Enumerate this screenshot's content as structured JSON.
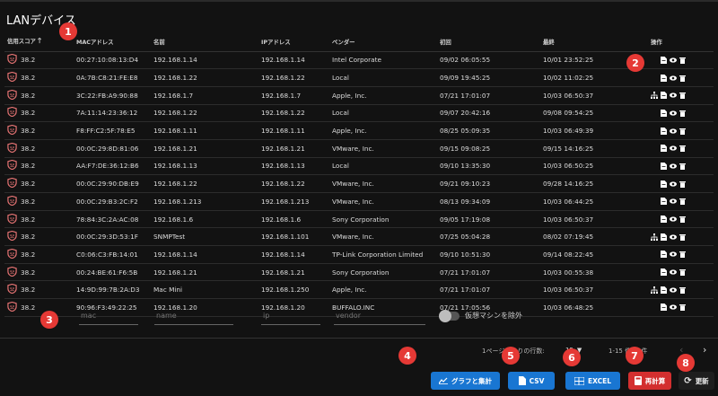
{
  "page_title": "LANデバイス",
  "columns": {
    "score": "信用スコア",
    "mac": "MACアドレス",
    "name": "名前",
    "ip": "IPアドレス",
    "vendor": "ベンダー",
    "first": "初回",
    "last": "最終",
    "actions": "操作"
  },
  "rows": [
    {
      "score": "38.2",
      "mac": "00:27:10:08:13:D4",
      "name": "192.168.1.14",
      "ip": "192.168.1.14",
      "vendor": "Intel Corporate",
      "first": "09/02 06:05:55",
      "last": "10/01 23:52:25",
      "icons": [
        "file-icon",
        "eye-icon",
        "trash-icon"
      ]
    },
    {
      "score": "38.2",
      "mac": "0A:7B:C8:21:FE:E8",
      "name": "192.168.1.22",
      "ip": "192.168.1.22",
      "vendor": "Local",
      "first": "09/09 19:45:25",
      "last": "10/02 11:02:25",
      "icons": [
        "file-icon",
        "eye-icon",
        "trash-icon"
      ]
    },
    {
      "score": "38.2",
      "mac": "3C:22:FB:A9:90:88",
      "name": "192.168.1.7",
      "ip": "192.168.1.7",
      "vendor": "Apple, Inc.",
      "first": "07/21 17:01:07",
      "last": "10/03 06:50:37",
      "icons": [
        "network-icon",
        "file-icon",
        "eye-icon",
        "trash-icon"
      ]
    },
    {
      "score": "38.2",
      "mac": "7A:11:14:23:36:12",
      "name": "192.168.1.22",
      "ip": "192.168.1.22",
      "vendor": "Local",
      "first": "09/07 20:42:16",
      "last": "09/08 09:54:25",
      "icons": [
        "file-icon",
        "eye-icon",
        "trash-icon"
      ]
    },
    {
      "score": "38.2",
      "mac": "F8:FF:C2:5F:78:E5",
      "name": "192.168.1.11",
      "ip": "192.168.1.11",
      "vendor": "Apple, Inc.",
      "first": "08/25 05:09:35",
      "last": "10/03 06:49:39",
      "icons": [
        "file-icon",
        "eye-icon",
        "trash-icon"
      ]
    },
    {
      "score": "38.2",
      "mac": "00:0C:29:8D:81:06",
      "name": "192.168.1.21",
      "ip": "192.168.1.21",
      "vendor": "VMware, Inc.",
      "first": "09/15 09:08:25",
      "last": "09/15 14:16:25",
      "icons": [
        "file-icon",
        "eye-icon",
        "trash-icon"
      ]
    },
    {
      "score": "38.2",
      "mac": "AA:F7:DE:36:12:B6",
      "name": "192.168.1.13",
      "ip": "192.168.1.13",
      "vendor": "Local",
      "first": "09/10 13:35:30",
      "last": "10/03 06:50:25",
      "icons": [
        "file-icon",
        "eye-icon",
        "trash-icon"
      ]
    },
    {
      "score": "38.2",
      "mac": "00:0C:29:90:DB:E9",
      "name": "192.168.1.22",
      "ip": "192.168.1.22",
      "vendor": "VMware, Inc.",
      "first": "09/21 09:10:23",
      "last": "09/28 14:16:25",
      "icons": [
        "file-icon",
        "eye-icon",
        "trash-icon"
      ]
    },
    {
      "score": "38.2",
      "mac": "00:0C:29:B3:2C:F2",
      "name": "192.168.1.213",
      "ip": "192.168.1.213",
      "vendor": "VMware, Inc.",
      "first": "08/13 09:34:09",
      "last": "10/03 06:44:25",
      "icons": [
        "file-icon",
        "eye-icon",
        "trash-icon"
      ]
    },
    {
      "score": "38.2",
      "mac": "78:84:3C:2A:AC:08",
      "name": "192.168.1.6",
      "ip": "192.168.1.6",
      "vendor": "Sony Corporation",
      "first": "09/05 17:19:08",
      "last": "10/03 06:50:37",
      "icons": [
        "file-icon",
        "eye-icon",
        "trash-icon"
      ]
    },
    {
      "score": "38.2",
      "mac": "00:0C:29:3D:53:1F",
      "name": "SNMPTest",
      "ip": "192.168.1.101",
      "vendor": "VMware, Inc.",
      "first": "07/25 05:04:28",
      "last": "08/02 07:19:45",
      "icons": [
        "network-icon",
        "file-icon",
        "eye-icon",
        "trash-icon"
      ]
    },
    {
      "score": "38.2",
      "mac": "C0:06:C3:FB:14:01",
      "name": "192.168.1.14",
      "ip": "192.168.1.14",
      "vendor": "TP-Link Corporation Limited",
      "first": "09/10 10:51:30",
      "last": "09/14 08:22:45",
      "icons": [
        "file-icon",
        "eye-icon",
        "trash-icon"
      ]
    },
    {
      "score": "38.2",
      "mac": "00:24:BE:61:F6:5B",
      "name": "192.168.1.21",
      "ip": "192.168.1.21",
      "vendor": "Sony Corporation",
      "first": "07/21 17:01:07",
      "last": "10/03 00:55:38",
      "icons": [
        "file-icon",
        "eye-icon",
        "trash-icon"
      ]
    },
    {
      "score": "38.2",
      "mac": "14:9D:99:7B:2A:D3",
      "name": "Mac Mini",
      "ip": "192.168.1.250",
      "vendor": "Apple, Inc.",
      "first": "07/21 17:01:07",
      "last": "10/03 06:50:37",
      "icons": [
        "network-icon",
        "file-icon",
        "eye-icon",
        "trash-icon"
      ]
    },
    {
      "score": "38.2",
      "mac": "90:96:F3:49:22:25",
      "name": "192.168.1.20",
      "ip": "192.168.1.20",
      "vendor": "BUFFALO.INC",
      "first": "07/21 17:05:56",
      "last": "10/03 06:48:25",
      "icons": [
        "file-icon",
        "eye-icon",
        "trash-icon"
      ]
    }
  ],
  "filters": {
    "mac": "mac",
    "name": "name",
    "ip": "ip",
    "vendor": "vendor",
    "vm_toggle_label": "仮想マシンを除外"
  },
  "pagination": {
    "rows_per_page_label": "1ページあたりの行数:",
    "rows_per_page_value": "15",
    "range": "1-15 件/15件"
  },
  "buttons": {
    "graph": "グラフと集計",
    "csv": "CSV",
    "excel": "EXCEL",
    "recalc": "再計算",
    "refresh": "更新"
  },
  "badges": [
    "1",
    "2",
    "3",
    "4",
    "5",
    "6",
    "7",
    "8"
  ],
  "colors": {
    "background": "#121212",
    "score_icon": "#e57373",
    "blue_button": "#1976d2",
    "red_button": "#d32f2f",
    "badge": "#e53935"
  }
}
